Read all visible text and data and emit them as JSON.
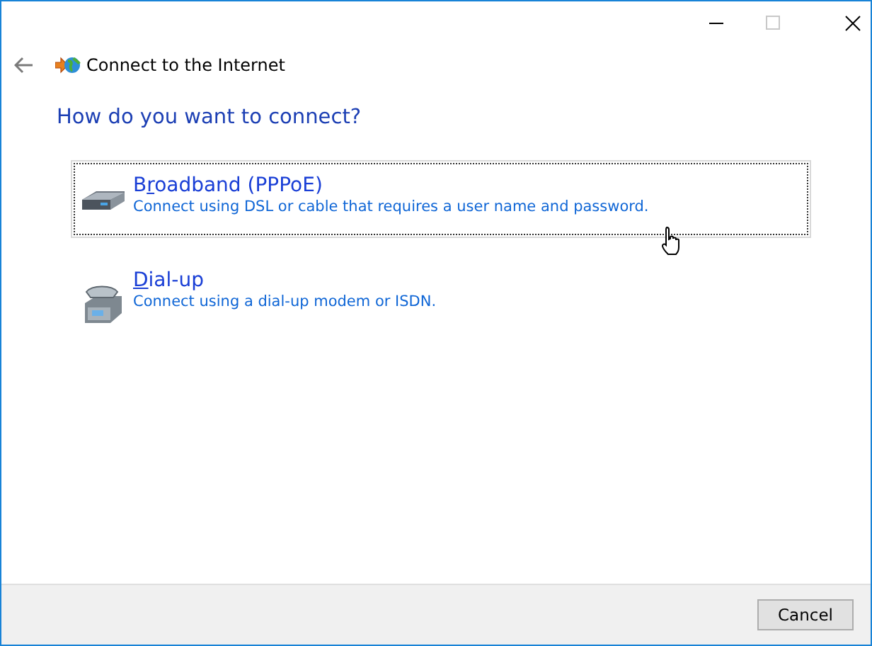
{
  "window": {
    "title": "Connect to the Internet"
  },
  "heading": "How do you want to connect?",
  "options": [
    {
      "kind": "broadband",
      "title": {
        "before": "B",
        "key": "r",
        "after": "oadband (PPPoE)"
      },
      "description": "Connect using DSL or cable that requires a user name and password.",
      "selected": true
    },
    {
      "kind": "dialup",
      "title": {
        "key": "D",
        "after": "ial-up"
      },
      "description": "Connect using a dial-up modem or ISDN.",
      "selected": false
    }
  ],
  "buttons": [
    "Cancel"
  ]
}
